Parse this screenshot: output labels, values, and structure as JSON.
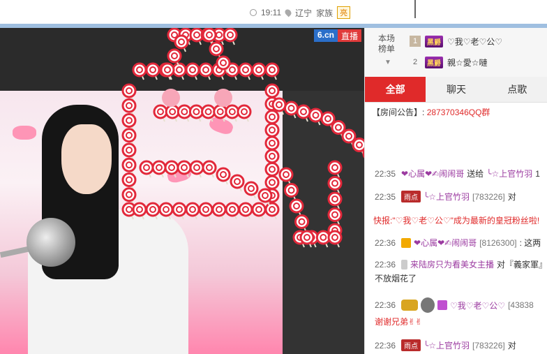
{
  "top": {
    "time": "19:11",
    "location": "辽宁",
    "family_label": "家族",
    "family_badge": "亮"
  },
  "video": {
    "logo_primary": "6.cn",
    "logo_secondary": "直播"
  },
  "rank": {
    "title_line1": "本场",
    "title_line2": "榜单",
    "items": [
      {
        "num": "1",
        "badge": "黑爵",
        "name": "♡我♡老♡公♡"
      },
      {
        "num": "2",
        "badge": "黑爵",
        "name": "親☆愛☆嗹"
      }
    ]
  },
  "tabs": [
    "全部",
    "聊天",
    "点歌"
  ],
  "notice": {
    "label": "【房间公告】:",
    "value": "287370346QQ群"
  },
  "messages": [
    {
      "time": "22:35",
      "user": "❤心属❤✍闹闹哥",
      "action": "送给",
      "target": "╰☆上官竹羽",
      "extra": "1"
    },
    {
      "time": "22:35",
      "tag": "雨点",
      "user": "╰☆上官竹羽",
      "uid": "[783226]",
      "text": "对"
    },
    {
      "quick": "快报:\"♡我♡老♡公♡\"成为最新的皇冠粉丝啦!"
    },
    {
      "time": "22:36",
      "user": "❤心属❤✍闹闹哥",
      "uid": "[8126300]",
      "text": ": 这两"
    },
    {
      "time": "22:36",
      "user": "来陆房只为看美女主播",
      "text": "对『義家軍』"
    },
    {
      "body": "不放烟花了"
    },
    {
      "time": "22:36",
      "user": "♡我♡老♡公♡",
      "uid": "[43838"
    },
    {
      "body": "谢谢兄弟✌✌"
    },
    {
      "time": "22:36",
      "tag": "雨点",
      "user": "╰☆上官竹羽",
      "uid": "[783226]",
      "text": "对"
    }
  ]
}
